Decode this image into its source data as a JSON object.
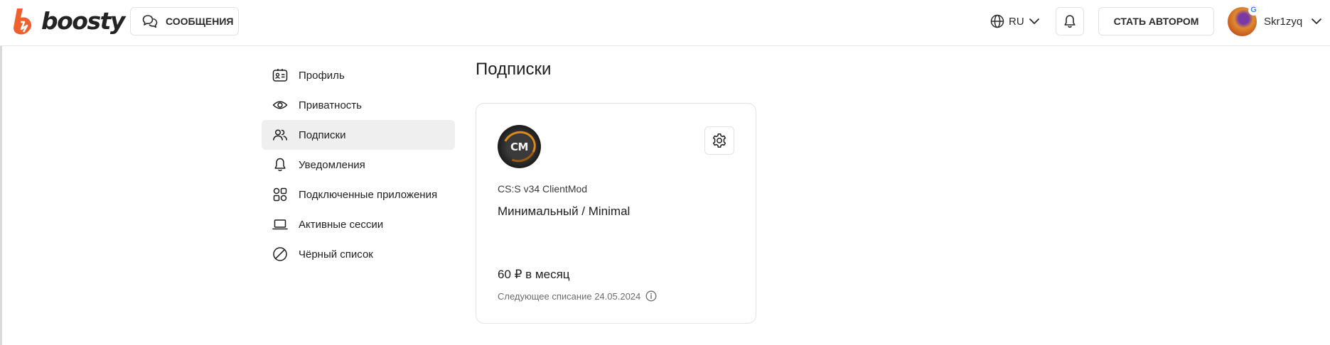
{
  "brand": {
    "name": "boosty",
    "color": "#f15f2c"
  },
  "header": {
    "messages_label": "СООБЩЕНИЯ",
    "language": "RU",
    "become_author_label": "СТАТЬ АВТОРОМ",
    "user": {
      "name": "Skr1zyq",
      "badge": "G"
    }
  },
  "sidebar": {
    "items": [
      {
        "label": "Профиль",
        "icon": "profile-card-icon",
        "active": false
      },
      {
        "label": "Приватность",
        "icon": "eye-icon",
        "active": false
      },
      {
        "label": "Подписки",
        "icon": "users-icon",
        "active": true
      },
      {
        "label": "Уведомления",
        "icon": "bell-icon",
        "active": false
      },
      {
        "label": "Подключенные приложения",
        "icon": "apps-icon",
        "active": false
      },
      {
        "label": "Активные сессии",
        "icon": "laptop-icon",
        "active": false
      },
      {
        "label": "Чёрный список",
        "icon": "block-icon",
        "active": false
      }
    ]
  },
  "main": {
    "title": "Подписки",
    "subscriptions": [
      {
        "avatar_text": "CM",
        "author": "CS:S v34 ClientMod",
        "tier": "Минимальный / Minimal",
        "price": "60 ₽ в месяц",
        "next_charge": "Следующее списание 24.05.2024"
      }
    ]
  }
}
